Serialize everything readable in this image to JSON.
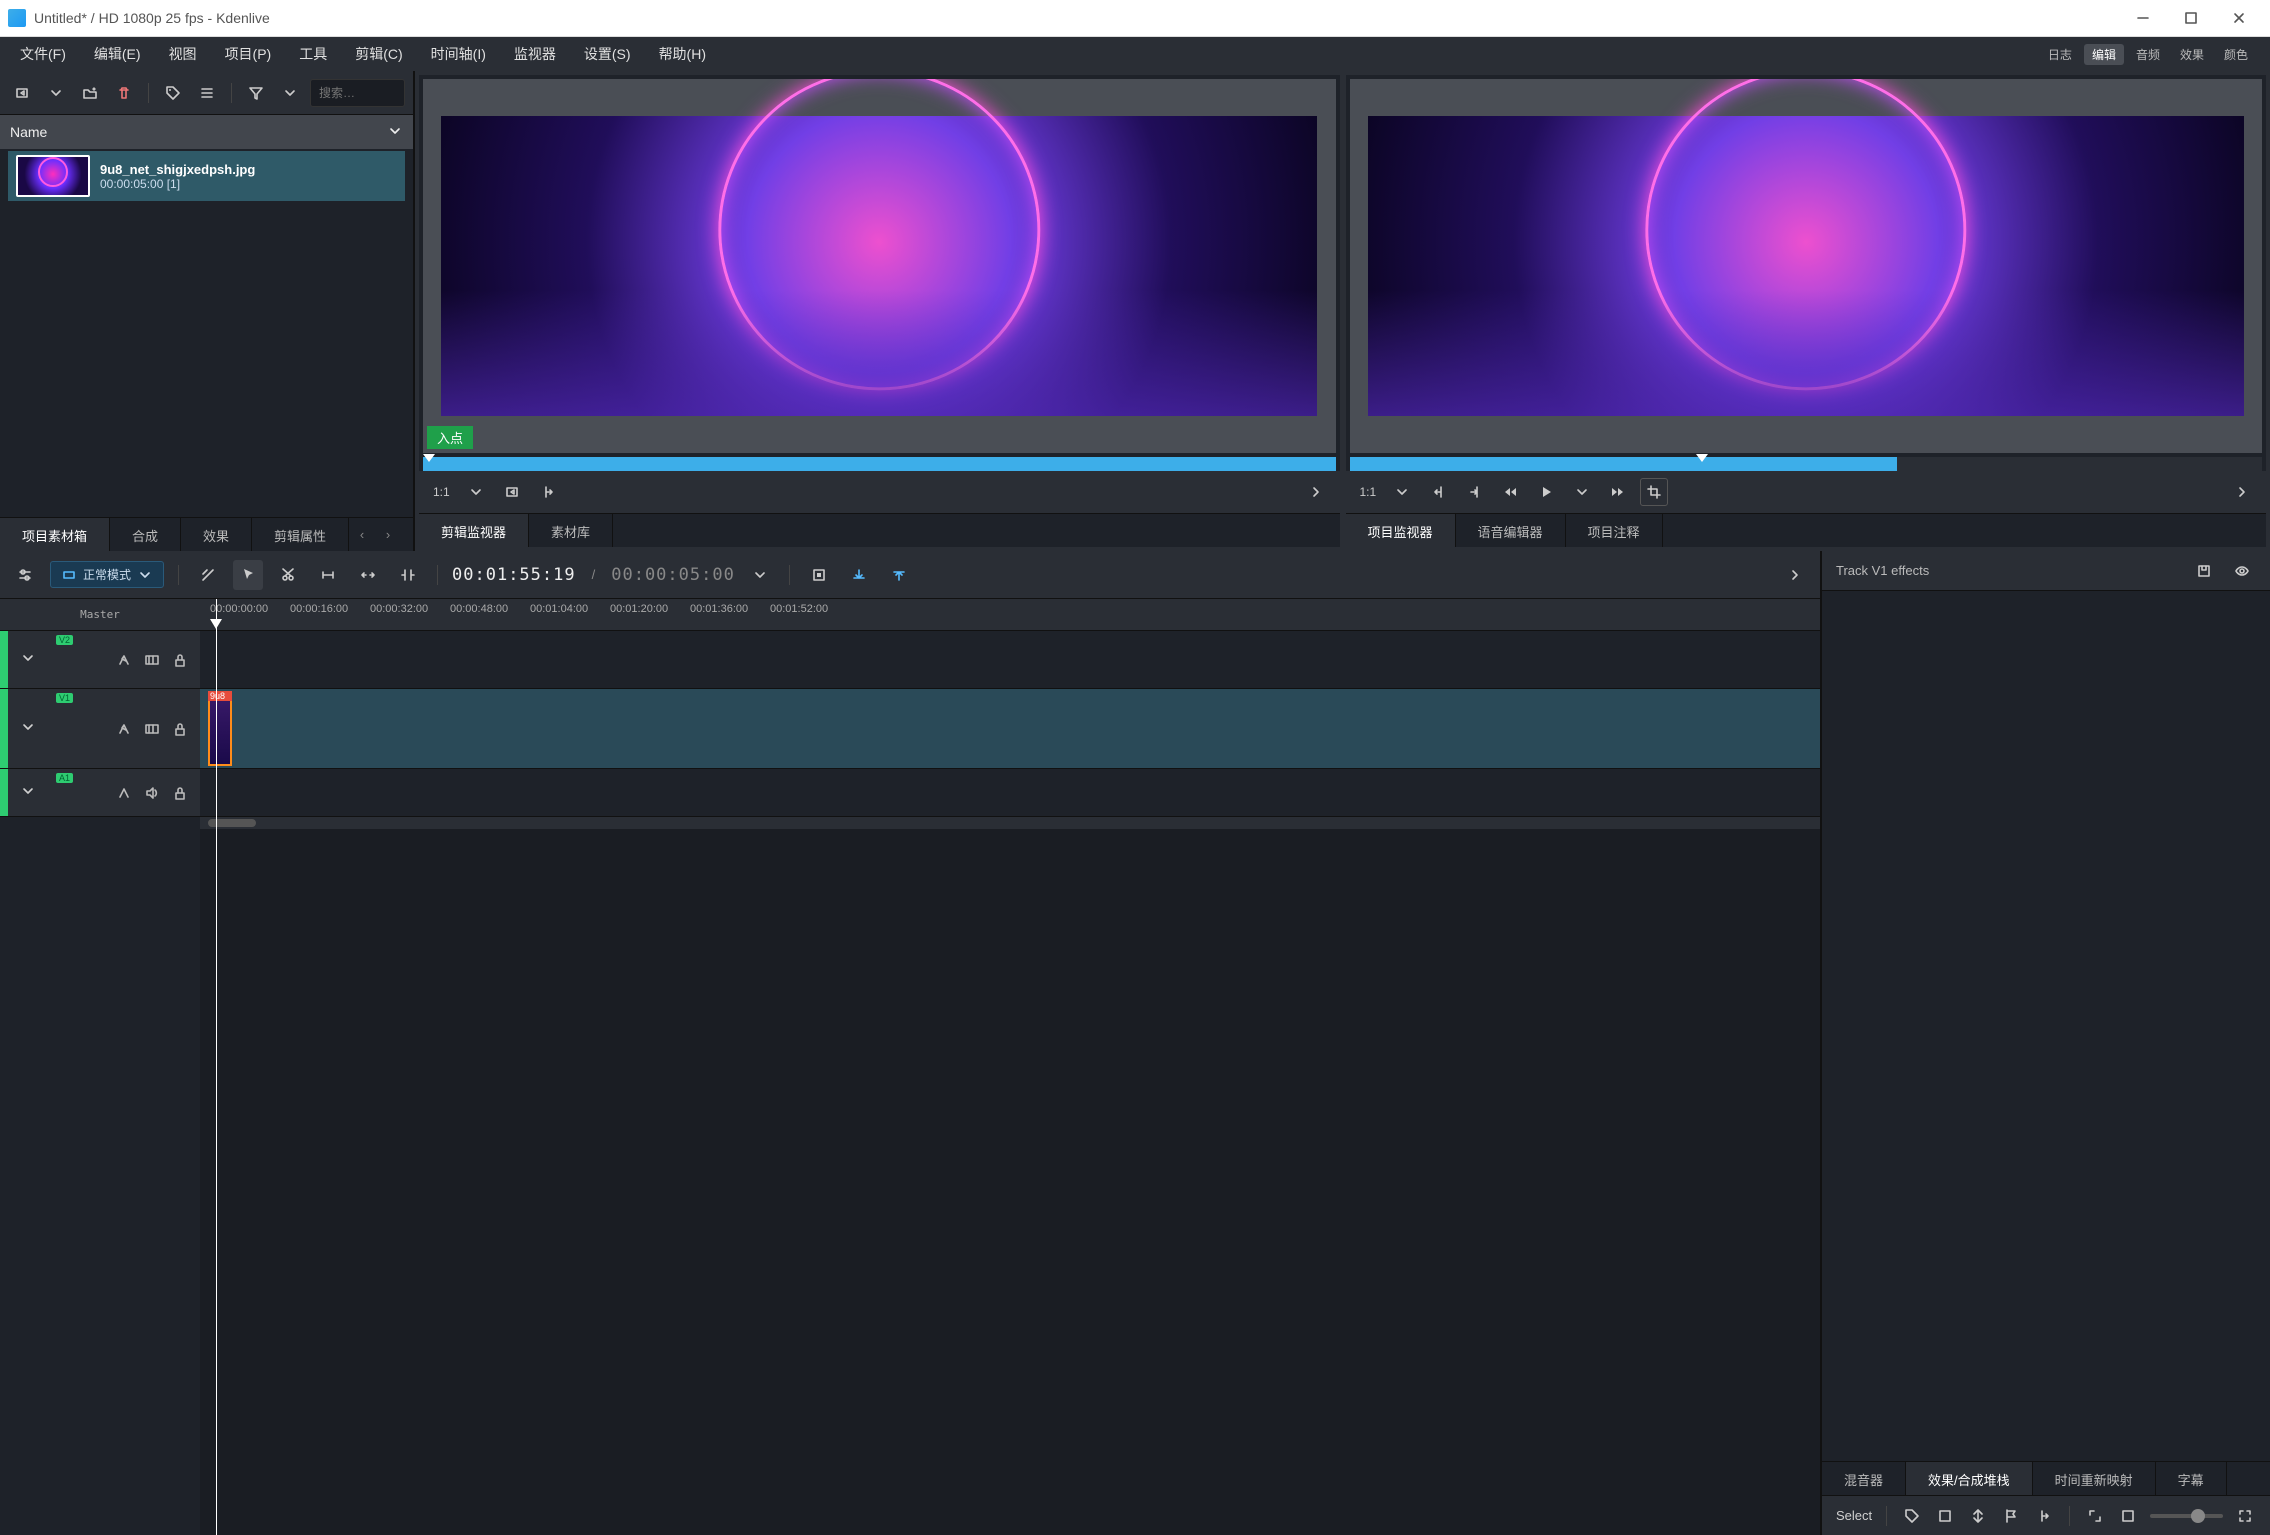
{
  "window": {
    "title": "Untitled* / HD 1080p 25 fps - Kdenlive"
  },
  "menus": {
    "file": "文件(F)",
    "edit": "编辑(E)",
    "view": "视图",
    "project": "项目(P)",
    "tools": "工具",
    "clip": "剪辑(C)",
    "timeline": "时间轴(I)",
    "monitor": "监视器",
    "settings": "设置(S)",
    "help": "帮助(H)"
  },
  "badges": {
    "log": "日志",
    "edit": "编辑",
    "audio": "音频",
    "effects": "效果",
    "color": "颜色"
  },
  "bin": {
    "search_placeholder": "搜索…",
    "header": "Name",
    "clip": {
      "name": "9u8_net_shigjxedpsh.jpg",
      "duration": "00:00:05:00 [1]"
    }
  },
  "bin_tabs": {
    "project_bin": "项目素材箱",
    "composition": "合成",
    "effects": "效果",
    "clip_properties": "剪辑属性"
  },
  "clip_monitor": {
    "in_point": "入点",
    "zoom": "1:1",
    "tab_clip": "剪辑监视器",
    "tab_library": "素材库"
  },
  "project_monitor": {
    "zoom": "1:1",
    "tab_project": "项目监视器",
    "tab_voice": "语音编辑器",
    "tab_notes": "项目注释"
  },
  "timeline": {
    "mode": "正常模式",
    "timecode": "00:01:55:19",
    "duration": "00:00:05:00",
    "master": "Master",
    "ticks": [
      "00:00:00:00",
      "00:00:16:00",
      "00:00:32:00",
      "00:00:48:00",
      "00:01:04:00",
      "00:01:20:00",
      "00:01:36:00",
      "00:01:52:00"
    ],
    "tracks": {
      "v2": "V2",
      "v1": "V1",
      "a1": "A1"
    },
    "clip_label": "9u8"
  },
  "fx": {
    "title": "Track V1 effects",
    "tab_mixer": "混音器",
    "tab_stack": "效果/合成堆栈",
    "tab_remap": "时间重新映射",
    "tab_subtitle": "字幕"
  },
  "status": {
    "select": "Select"
  }
}
